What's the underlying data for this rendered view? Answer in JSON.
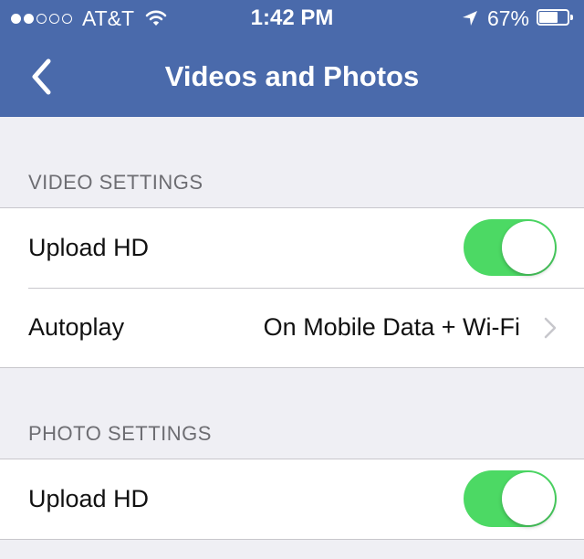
{
  "status_bar": {
    "carrier": "AT&T",
    "time": "1:42 PM",
    "battery_percent": "67%",
    "battery_level": 0.67,
    "signal_bars_filled": 2,
    "signal_bars_total": 5
  },
  "nav": {
    "title": "Videos and Photos",
    "back_icon": "chevron-left-icon"
  },
  "video_settings": {
    "header": "VIDEO SETTINGS",
    "upload_hd_label": "Upload HD",
    "upload_hd_on": true,
    "autoplay_label": "Autoplay",
    "autoplay_value": "On Mobile Data + Wi-Fi"
  },
  "photo_settings": {
    "header": "PHOTO SETTINGS",
    "upload_hd_label": "Upload HD",
    "upload_hd_on": true
  },
  "colors": {
    "nav_background": "#4a6aab",
    "toggle_on": "#4cd964",
    "page_background": "#efeff4"
  }
}
